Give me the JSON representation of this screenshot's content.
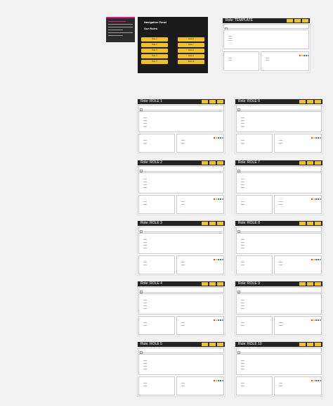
{
  "intro_note": {
    "title": "",
    "accent_color": "#e0157a"
  },
  "nav_panel": {
    "title": "Navigation Panel",
    "subtitle": "Our Roles",
    "role_buttons": [
      "Role 1",
      "Role 6",
      "Role 2",
      "Role 7",
      "Role 3",
      "Role 8",
      "Role 4",
      "Role 9",
      "Role 5",
      "Role 10"
    ],
    "button_color": "#f2c21b"
  },
  "template_board": {
    "title": "Role: TEMPLATE",
    "buttons": [
      "",
      "",
      ""
    ]
  },
  "role_boards": [
    {
      "title": "Role: ROLE 1"
    },
    {
      "title": "Role: ROLE 6"
    },
    {
      "title": "Role: ROLE 2"
    },
    {
      "title": "Role: ROLE 7"
    },
    {
      "title": "Role: ROLE 3"
    },
    {
      "title": "Role: ROLE 8"
    },
    {
      "title": "Role: ROLE 4"
    },
    {
      "title": "Role: ROLE 9"
    },
    {
      "title": "Role: ROLE 5"
    },
    {
      "title": "Role: ROLE 10"
    }
  ],
  "board_sections": {
    "purpose_label": "Purpose",
    "accountabilities_label": "Accountabilities",
    "domains_label": "Domains",
    "energizers_label": "Energizers"
  },
  "colors": {
    "board_header": "#232323",
    "accent_yellow": "#f2c21b",
    "canvas": "#f1f1f1"
  },
  "board_logo_colors": [
    "#e8432e",
    "#f2c21b",
    "#2f8f3f",
    "#2c6fd6",
    "#9a9a9a"
  ]
}
